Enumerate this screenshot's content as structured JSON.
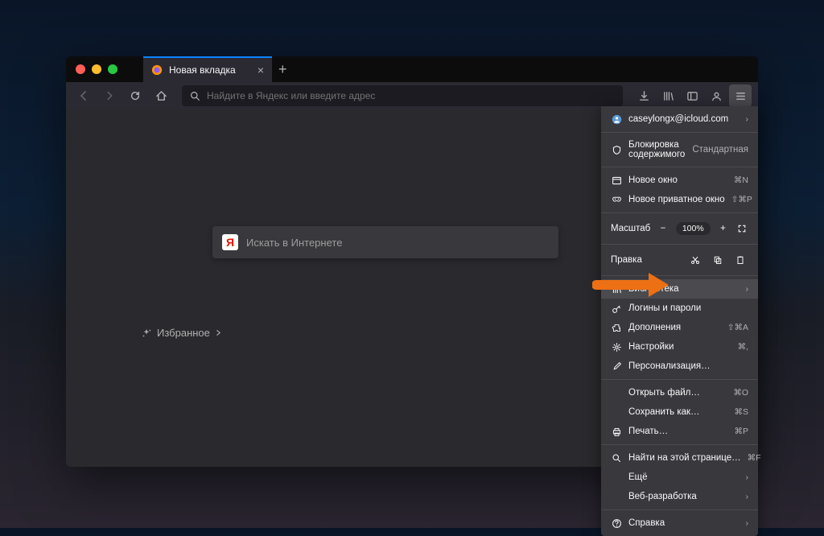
{
  "tab": {
    "title": "Новая вкладка"
  },
  "urlbar": {
    "placeholder": "Найдите в Яндекс или введите адрес"
  },
  "content": {
    "search_placeholder": "Искать в Интернете",
    "favorites_label": "Избранное"
  },
  "menu": {
    "account": "caseylongx@icloud.com",
    "content_block_label": "Блокировка содержимого",
    "content_block_status": "Стандартная",
    "new_window": "Новое окно",
    "new_window_sc": "⌘N",
    "new_private": "Новое приватное окно",
    "new_private_sc": "⇧⌘P",
    "zoom_label": "Масштаб",
    "zoom_value": "100%",
    "edit_label": "Правка",
    "library": "Библиотека",
    "logins": "Логины и пароли",
    "addons": "Дополнения",
    "addons_sc": "⇧⌘A",
    "prefs": "Настройки",
    "prefs_sc": "⌘,",
    "customize": "Персонализация…",
    "open_file": "Открыть файл…",
    "open_file_sc": "⌘O",
    "save_as": "Сохранить как…",
    "save_as_sc": "⌘S",
    "print": "Печать…",
    "print_sc": "⌘P",
    "find": "Найти на этой странице…",
    "find_sc": "⌘F",
    "more": "Ещё",
    "webdev": "Веб-разработка",
    "help": "Справка"
  }
}
